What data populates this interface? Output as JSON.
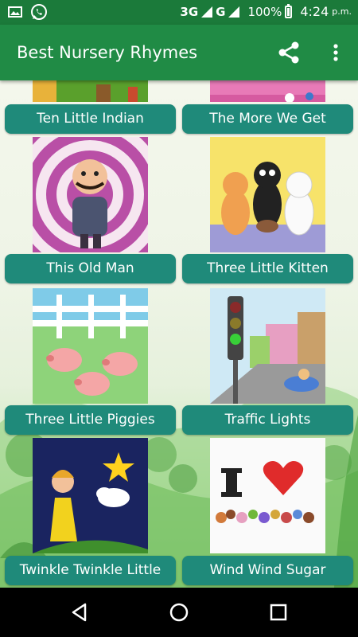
{
  "status_bar": {
    "network": "3G",
    "network2": "G",
    "battery": "100%",
    "time": "4:24",
    "ampm": "p.m."
  },
  "app_bar": {
    "title": "Best Nursery Rhymes",
    "share_icon": "share-icon",
    "menu_icon": "more-vert-icon"
  },
  "colors": {
    "status_bar": "#1b7a3a",
    "app_bar": "#208b45",
    "tile_button": "#1f8a7a"
  },
  "rhymes": [
    {
      "label": "Ten Little Indian"
    },
    {
      "label": "The More We Get"
    },
    {
      "label": "This Old Man"
    },
    {
      "label": "Three Little Kitten"
    },
    {
      "label": "Three Little Piggies"
    },
    {
      "label": "Traffic Lights"
    },
    {
      "label": "Twinkle Twinkle Little"
    },
    {
      "label": "Wind Wind Sugar"
    }
  ],
  "nav_bar": {
    "back_icon": "back-triangle-icon",
    "home_icon": "home-circle-icon",
    "recents_icon": "recents-square-icon"
  }
}
